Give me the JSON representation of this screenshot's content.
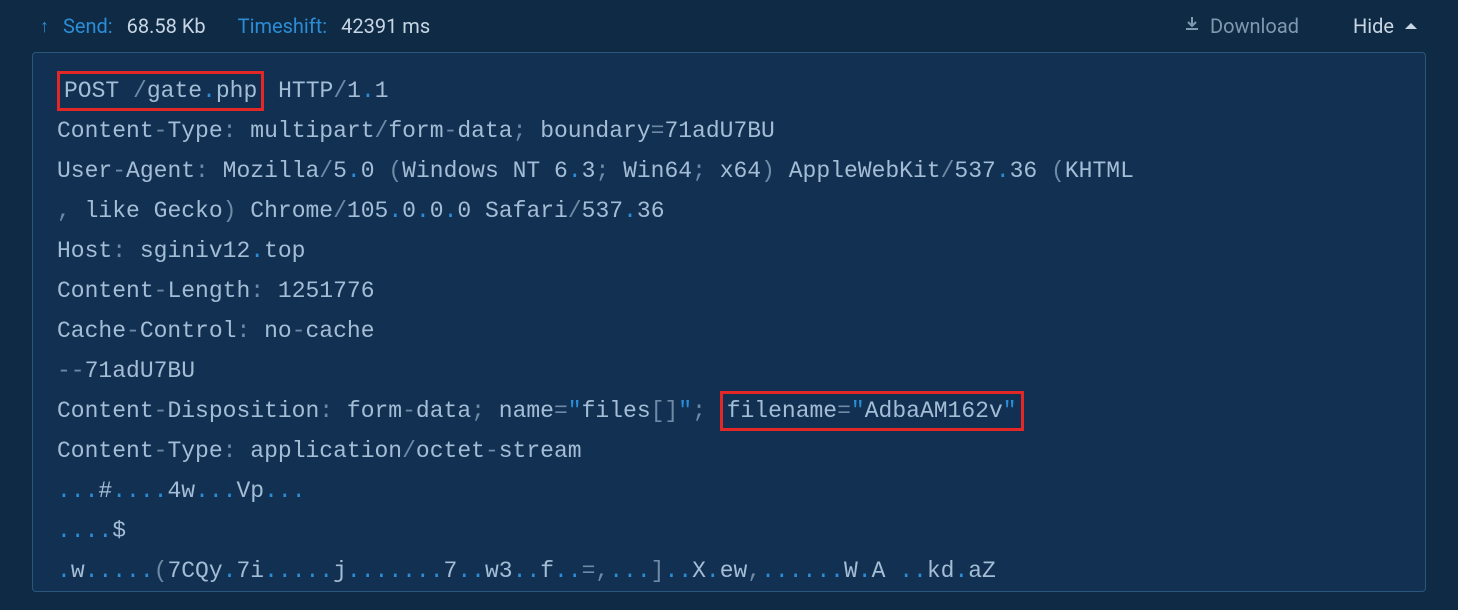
{
  "header": {
    "send_label": "Send:",
    "size_value": "68.58 Kb",
    "timeshift_label": "Timeshift:",
    "timeshift_value": "42391 ms",
    "download_label": "Download",
    "hide_label": "Hide"
  },
  "request": {
    "method": "POST",
    "path": "/gate.php",
    "protocol": "HTTP",
    "version": "1.1",
    "content_type_header": "Content-Type",
    "content_type_main": "multipart",
    "content_type_sub": "form-data",
    "boundary_label": "boundary",
    "boundary_value": "71adU7BU",
    "user_agent_header": "User-Agent",
    "ua_mozilla": "Mozilla",
    "ua_mozver": "5.0",
    "ua_windows": "Windows NT 6",
    "ua_winver": "3",
    "ua_win64": "Win64",
    "ua_x64": "x64",
    "ua_webkit": "AppleWebKit",
    "ua_webkitver": "537.36",
    "ua_khtml1": "KHTML",
    "ua_like": "like Gecko",
    "ua_chrome": "Chrome",
    "ua_chromever": "105.0.0.0",
    "ua_safari": "Safari",
    "ua_safariver": "537.36",
    "host_header": "Host",
    "host_value": "sginiv12",
    "host_tld": "top",
    "content_length_header": "Content-Length",
    "content_length_value": "1251776",
    "cache_control_header": "Cache-Control",
    "cache_control_value": "no-cache",
    "boundary_prefix": "--",
    "content_disp_header": "Content-Disposition",
    "content_disp_value": "form-data",
    "name_label": "name",
    "name_value": "files[]",
    "filename_label": "filename",
    "filename_value": "AdbaAM162v",
    "part_ct_header": "Content-Type",
    "part_ct_main": "application",
    "part_ct_sub": "octet-stream",
    "raw_line1_a": "#",
    "raw_line1_b": "4w",
    "raw_line1_c": "Vp",
    "raw_line2_a": "$",
    "raw_line3_a": "w",
    "raw_line3_b": "7CQy",
    "raw_line3_c": "7i",
    "raw_line3_d": "j",
    "raw_line3_e": "7",
    "raw_line3_f": "w3",
    "raw_line3_g": "f",
    "raw_line3_h": "X",
    "raw_line3_i": "ew",
    "raw_line3_j": "W",
    "raw_line3_k": "A",
    "raw_line3_l": "kd",
    "raw_line3_m": "aZ"
  }
}
